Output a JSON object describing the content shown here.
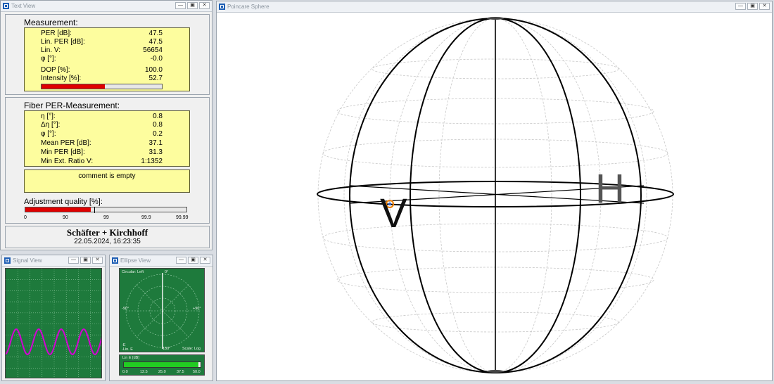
{
  "text_view": {
    "title": "Text View",
    "measurement": {
      "heading": "Measurement:",
      "rows": [
        {
          "label": "PER [dB]:",
          "value": "47.5"
        },
        {
          "label": "Lin. PER [dB]:",
          "value": "47.5"
        },
        {
          "label": "Lin. V:",
          "value": "56654"
        },
        {
          "label": "φ [°]:",
          "value": "-0.0"
        },
        {
          "label": "DOP [%]:",
          "value": "100.0"
        },
        {
          "label": "Intensity [%]:",
          "value": "52.7"
        }
      ],
      "intensity_fraction": 0.527
    },
    "fiber": {
      "heading": "Fiber PER-Measurement:",
      "rows": [
        {
          "label": "η [°]:",
          "value": "0.8"
        },
        {
          "label": "Δη [°]:",
          "value": "0.8"
        },
        {
          "label": "φ [°]:",
          "value": "0.2"
        },
        {
          "label": "Mean PER [dB]:",
          "value": "37.1"
        },
        {
          "label": "Min  PER [dB]:",
          "value": "31.3"
        },
        {
          "label": "Min Ext. Ratio V:",
          "value": "1:1352"
        }
      ],
      "comment": "comment is empty",
      "adjustment_label": "Adjustment quality [%]:",
      "adjustment_ticks": [
        "0",
        "90",
        "99",
        "99.9",
        "99.99"
      ],
      "adjustment_fraction": 0.405
    },
    "footer": {
      "company": "Schäfter + Kirchhoff",
      "timestamp": "22.05.2024, 16:23:35"
    }
  },
  "signal_view": {
    "title": "Signal View"
  },
  "ellipse_view": {
    "title": "Ellipse View",
    "labels": {
      "circular_left": "Circular: Left",
      "top": "0°",
      "left": "-90°",
      "right": "+90°",
      "bottom": "180°",
      "e": "-E",
      "lin_e": "-Lin. E",
      "scale": "Scale: Log"
    },
    "lin_e_label": "Lin E [dB]",
    "lin_e_fraction": 0.97,
    "lin_e_ticks": [
      "0.0",
      "12.5",
      "25.0",
      "37.5",
      "50.0"
    ]
  },
  "poincare": {
    "title": "Poincare Sphere",
    "label_h": "H",
    "label_v": "V"
  },
  "colors": {
    "yellow_box": "#fdfd9e",
    "bar_red": "#e00000",
    "scope_green": "#1e7a3c",
    "signal_magenta": "#d400d4",
    "lin_green": "#22cc22"
  },
  "window_controls": {
    "minimize": "—",
    "restore": "▣",
    "close": "✕"
  }
}
